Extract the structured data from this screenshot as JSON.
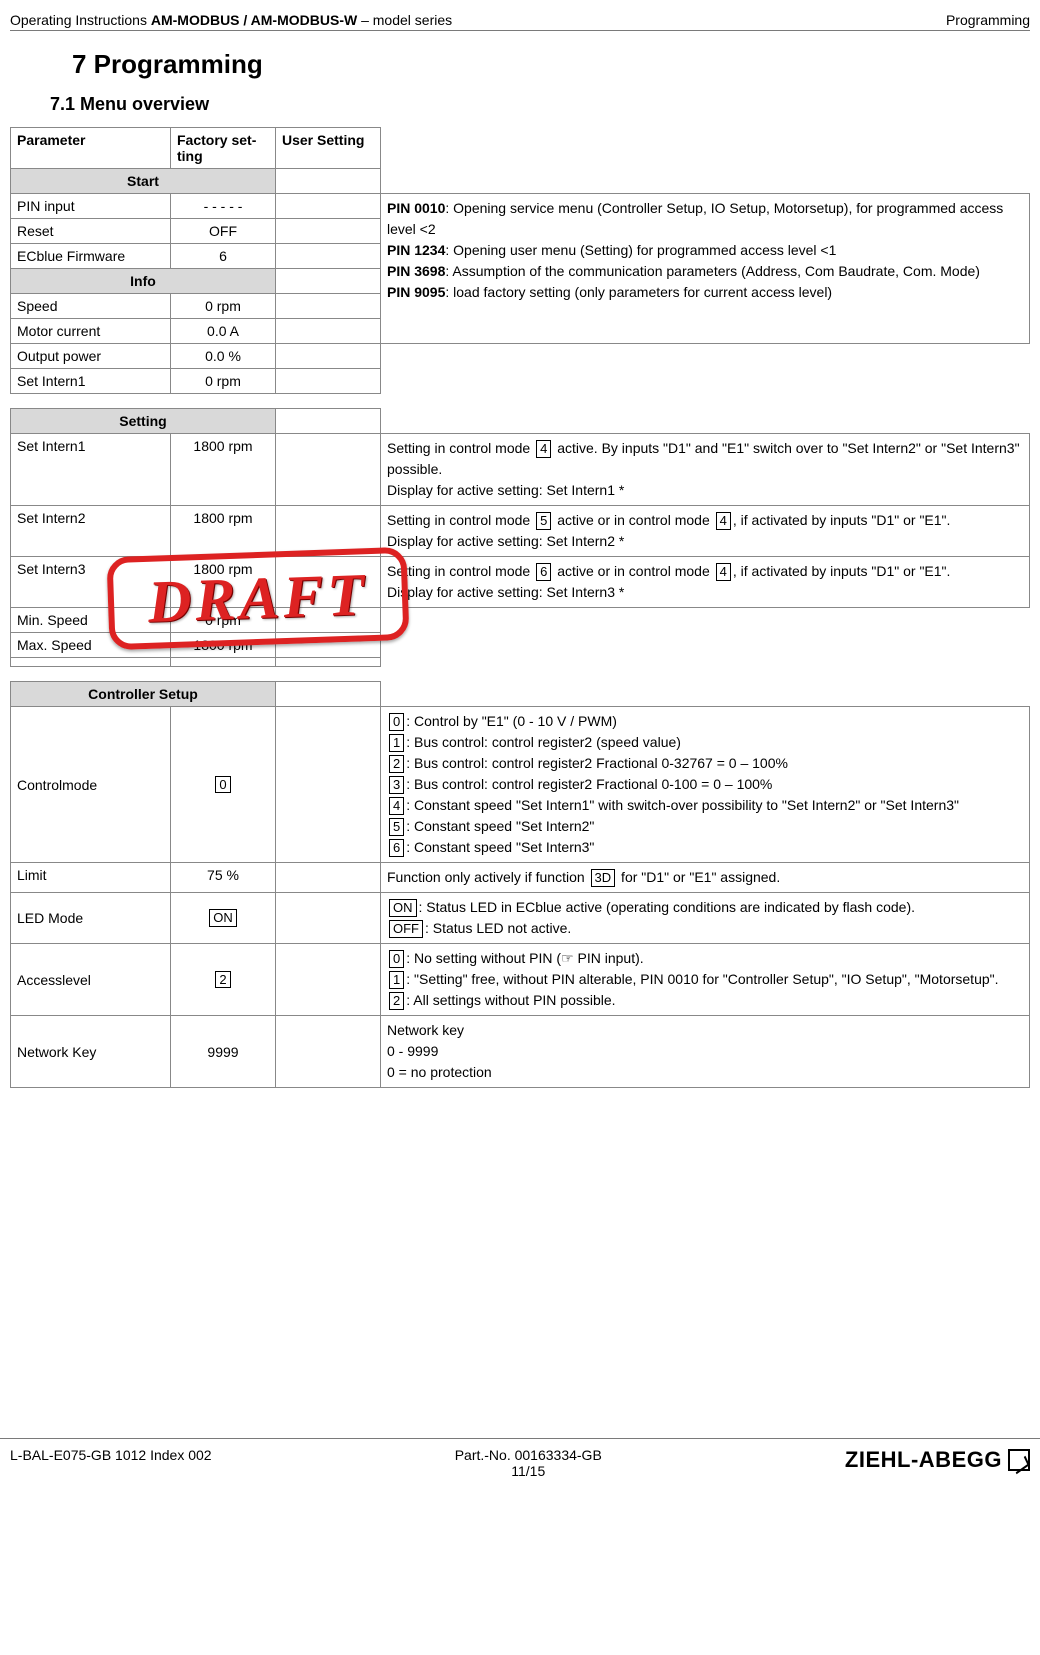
{
  "header": {
    "left_pre": "Operating Instructions ",
    "left_bold": "AM-MODBUS / AM-MODBUS-W",
    "left_post": " – model series",
    "right": "Programming"
  },
  "h1": "7   Programming",
  "h2": "7.1     Menu overview",
  "cols": {
    "parameter": "Parameter",
    "factory": "Factory set-\nting",
    "user": "User Setting"
  },
  "sections": {
    "start": "Start",
    "info": "Info",
    "setting": "Setting",
    "controller": "Controller Setup"
  },
  "start": {
    "pin_input": {
      "name": "PIN input",
      "factory": "- - - - -"
    },
    "reset": {
      "name": "Reset",
      "factory": "OFF"
    },
    "ecblue": {
      "name": "ECblue Firmware",
      "factory": "6"
    }
  },
  "info": {
    "speed": {
      "name": "Speed",
      "factory": "0 rpm"
    },
    "motor_current": {
      "name": "Motor current",
      "factory": "0.0 A"
    },
    "output_power": {
      "name": "Output power",
      "factory": "0.0 %"
    },
    "set_intern1": {
      "name": "Set Intern1",
      "factory": "0 rpm"
    }
  },
  "pin_desc": {
    "p0010_b": "PIN 0010",
    "p0010_t": ": Opening service menu (Controller Setup, IO Setup, Motorsetup), for programmed access level <2",
    "p1234_b": "PIN 1234",
    "p1234_t": ": Opening user menu (Setting) for programmed access level <1",
    "p3698_b": "PIN 3698",
    "p3698_t": ": Assumption of the communication parameters (Address, Com Baudrate, Com. Mode)",
    "p9095_b": "PIN 9095",
    "p9095_t": ": load factory setting (only  parameters for current access level)"
  },
  "setting": {
    "si1": {
      "name": "Set Intern1",
      "factory": "1800 rpm",
      "desc_a": "Setting in control mode ",
      "desc_b": " active. By inputs \"D1\" and \"E1\" switch over to \"Set Intern2\" or \"Set Intern3\" possible.",
      "desc_c": "Display for active setting: Set Intern1 *"
    },
    "si2": {
      "name": "Set Intern2",
      "factory": "1800 rpm",
      "desc_a": "Setting in control mode ",
      "desc_b": " active or in control mode ",
      "desc_c": ", if activated by inputs \"D1\" or \"E1\".",
      "desc_d": "Display for active setting: Set Intern2 *"
    },
    "si3": {
      "name": "Set Intern3",
      "factory": "1800 rpm",
      "desc_a": "Setting in control mode ",
      "desc_b": " active or in control mode ",
      "desc_c": ", if activated by inputs \"D1\" or \"E1\".",
      "desc_d": "Display for active setting: Set Intern3 *"
    },
    "minspeed": {
      "name": "Min. Speed",
      "factory": "0 rpm"
    },
    "maxspeed": {
      "name": "Max. Speed",
      "factory": "1800 rpm"
    }
  },
  "box": {
    "b0": "0",
    "b1": "1",
    "b2": "2",
    "b3": "3",
    "b3d": "3D",
    "b4": "4",
    "b5": "5",
    "b6": "6",
    "on": "ON",
    "off": "OFF"
  },
  "controller": {
    "controlmode": {
      "name": "Controlmode",
      "factory": "0",
      "l0": ": Control by \"E1\" (0 - 10 V / PWM)",
      "l1": ": Bus control: control register2 (speed value)",
      "l2": ": Bus control: control register2 Fractional 0-32767 = 0 – 100%",
      "l3": ": Bus control: control register2 Fractional 0-100 = 0 – 100%",
      "l4": ": Constant speed \"Set Intern1\" with switch-over possibility to \"Set Intern2\" or \"Set Intern3\"",
      "l5": ": Constant speed \"Set Intern2\"",
      "l6": ": Constant speed \"Set Intern3\""
    },
    "limit": {
      "name": "Limit",
      "factory": "75 %",
      "desc_a": "Function only actively if function ",
      "desc_b": " for \"D1\" or \"E1\" assigned."
    },
    "ledmode": {
      "name": "LED Mode",
      "factory": "ON",
      "l_on": ": Status LED in ECblue active (operating conditions are indicated by flash code).",
      "l_off": ": Status LED not active."
    },
    "accesslevel": {
      "name": "Accesslevel",
      "factory": "2",
      "l0": ": No setting without PIN (☞ PIN input).",
      "l1": ": \"Setting\" free, without PIN alterable, PIN 0010 for \"Controller Setup\", \"IO Setup\", \"Motorsetup\".",
      "l2": ": All settings without PIN possible."
    },
    "networkkey": {
      "name": "Network Key",
      "factory": "9999",
      "l1": "Network key",
      "l2": "0 - 9999",
      "l3": "0 = no protection"
    }
  },
  "footer": {
    "left": "L-BAL-E075-GB 1012 Index 002",
    "center1": "Part.-No. 00163334-GB",
    "center2": "11/15",
    "brand": "ZIEHL-ABEGG"
  },
  "stamp": "DRAFT"
}
